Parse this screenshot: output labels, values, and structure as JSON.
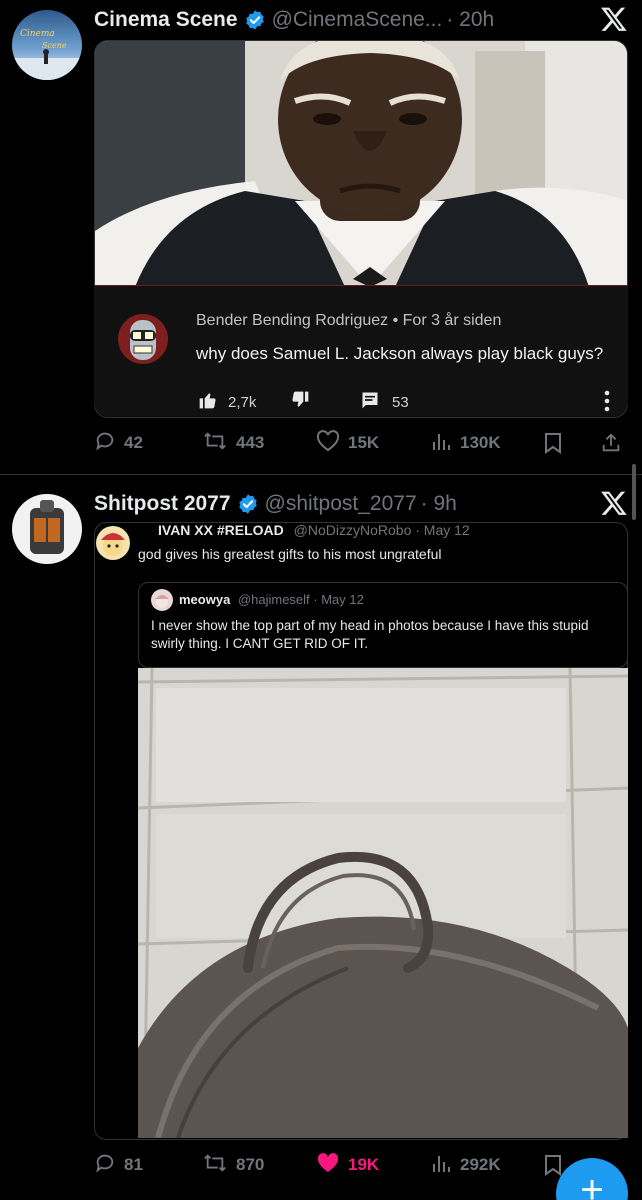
{
  "post1": {
    "name": "Cinema Scene",
    "handle": "@CinemaScene...",
    "time": "· 20h",
    "youtube_comment": {
      "author": "Bender Bending Rodriguez",
      "age": "For 3 år siden",
      "text": "why does Samuel L. Jackson always play black guys?",
      "likes": "2,7k",
      "replies": "53"
    },
    "actions": {
      "replies": "42",
      "reposts": "443",
      "likes": "15K",
      "views": "130K"
    }
  },
  "post2": {
    "name": "Shitpost 2077",
    "handle": "@shitpost_2077",
    "time": "· 9h",
    "quoted": {
      "name": "IVAN XX #RELOAD",
      "handle": "@NoDizzyNoRobo · May 12",
      "text": "god gives his greatest gifts to his most ungrateful",
      "inner": {
        "name": "meowya",
        "handle": "@hajimeself · May 12",
        "text": "I never show the top part of my head in photos because I have this stupid swirly thing. I CANT GET RID OF IT."
      }
    },
    "actions": {
      "replies": "81",
      "reposts": "870",
      "likes": "19K",
      "views": "292K"
    }
  },
  "colors": {
    "accent": "#1d9bf0",
    "like": "#f91880",
    "muted": "#71767b"
  },
  "icons": [
    "verified-badge-icon",
    "x-logo-icon",
    "reply-icon",
    "repost-icon",
    "heart-icon",
    "views-icon",
    "bookmark-icon",
    "share-icon",
    "thumbs-up-icon",
    "thumbs-down-icon",
    "comment-icon",
    "more-vertical-icon",
    "plus-icon"
  ],
  "fab": {
    "label": "+"
  }
}
